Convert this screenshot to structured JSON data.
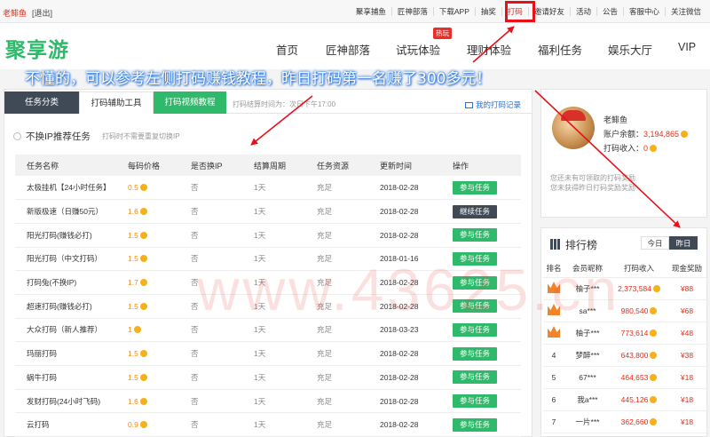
{
  "topbar": {
    "username": "老鲱鱼",
    "logout": "[退出]",
    "links": [
      "聚享捕鱼",
      "匠神部落",
      "下载APP",
      "抽奖",
      "打码",
      "邀请好友",
      "活动",
      "公告",
      "客服中心",
      "关注微信"
    ],
    "active_index": 4
  },
  "header": {
    "logo": "聚享游",
    "nav": [
      "首页",
      "匠神部落",
      "试玩体验",
      "理财体验",
      "福利任务",
      "娱乐大厅",
      "VIP"
    ],
    "hot_badge": "热玩"
  },
  "overlay": {
    "text": "不懂的，可以参考左侧打码赚钱教程，昨日打码第一名赚了300多元！"
  },
  "tabs": {
    "items": [
      "任务分类",
      "打码辅助工具",
      "打码视频教程"
    ],
    "note": "打码结算时间为：次日下午17:00",
    "my_record": "我的打码记录"
  },
  "section": {
    "title": "不换IP推荐任务",
    "note": "打码时不需要重复切换IP"
  },
  "table": {
    "headers": [
      "任务名称",
      "每码价格",
      "是否换IP",
      "结算周期",
      "任务资源",
      "更新时间",
      "操作"
    ],
    "rows": [
      {
        "name": "太极挂机【24小时任务】",
        "price": "0.5",
        "ip": "否",
        "cycle": "1天",
        "res": "充足",
        "date": "2018-02-28",
        "action": "参与任务"
      },
      {
        "name": "新版极速（日赚50元）",
        "price": "1.6",
        "ip": "否",
        "cycle": "1天",
        "res": "充足",
        "date": "2018-02-28",
        "action": "继续任务"
      },
      {
        "name": "阳光打码(赚钱必打)",
        "price": "1.5",
        "ip": "否",
        "cycle": "1天",
        "res": "充足",
        "date": "2018-02-28",
        "action": "参与任务"
      },
      {
        "name": "阳光打码（中文打码）",
        "price": "1.5",
        "ip": "否",
        "cycle": "1天",
        "res": "充足",
        "date": "2018-01-16",
        "action": "参与任务"
      },
      {
        "name": "打码兔(不换IP)",
        "price": "1.7",
        "ip": "否",
        "cycle": "1天",
        "res": "充足",
        "date": "2018-02-28",
        "action": "参与任务"
      },
      {
        "name": "超速打码(赚钱必打)",
        "price": "1.5",
        "ip": "否",
        "cycle": "1天",
        "res": "充足",
        "date": "2018-02-28",
        "action": "参与任务"
      },
      {
        "name": "大众打码（新人推荐）",
        "price": "1",
        "ip": "否",
        "cycle": "1天",
        "res": "充足",
        "date": "2018-03-23",
        "action": "参与任务"
      },
      {
        "name": "玛丽打码",
        "price": "1.5",
        "ip": "否",
        "cycle": "1天",
        "res": "充足",
        "date": "2018-02-28",
        "action": "参与任务"
      },
      {
        "name": "蜗牛打码",
        "price": "1.5",
        "ip": "否",
        "cycle": "1天",
        "res": "充足",
        "date": "2018-02-28",
        "action": "参与任务"
      },
      {
        "name": "发财打码(24小时飞码)",
        "price": "1.6",
        "ip": "否",
        "cycle": "1天",
        "res": "充足",
        "date": "2018-02-28",
        "action": "参与任务"
      },
      {
        "name": "云打码",
        "price": "0.9",
        "ip": "否",
        "cycle": "1天",
        "res": "充足",
        "date": "2018-02-28",
        "action": "参与任务"
      }
    ]
  },
  "account": {
    "name": "老鲱鱼",
    "balance_label": "账户余额：",
    "balance": "3,194,865",
    "income_label": "打码收入：",
    "income": "0",
    "note1": "您还未有可领取的打码奖励",
    "note2": "您未获得昨日打码奖励奖励"
  },
  "ranking": {
    "title": "排行榜",
    "tab_today": "今日",
    "tab_yesterday": "昨日",
    "headers": [
      "排名",
      "会员昵称",
      "打码收入",
      "现金奖励"
    ],
    "rows": [
      {
        "rank": "",
        "name": "柚子***",
        "income": "2,373,584",
        "reward": "¥88"
      },
      {
        "rank": "",
        "name": "sa***",
        "income": "980,540",
        "reward": "¥68"
      },
      {
        "rank": "",
        "name": "柚子***",
        "income": "773,614",
        "reward": "¥48"
      },
      {
        "rank": "4",
        "name": "梦醉***",
        "income": "643,800",
        "reward": "¥38"
      },
      {
        "rank": "5",
        "name": "67***",
        "income": "464,653",
        "reward": "¥18"
      },
      {
        "rank": "6",
        "name": "我a***",
        "income": "445,126",
        "reward": "¥18"
      },
      {
        "rank": "7",
        "name": "一片***",
        "income": "362,660",
        "reward": "¥18"
      }
    ]
  },
  "watermark": "www.43625.cn",
  "colors": {
    "brand_green": "#2fb96a",
    "dark_tab": "#404a57",
    "accent_red": "#e0301e",
    "annotation_red": "#e8101a"
  }
}
